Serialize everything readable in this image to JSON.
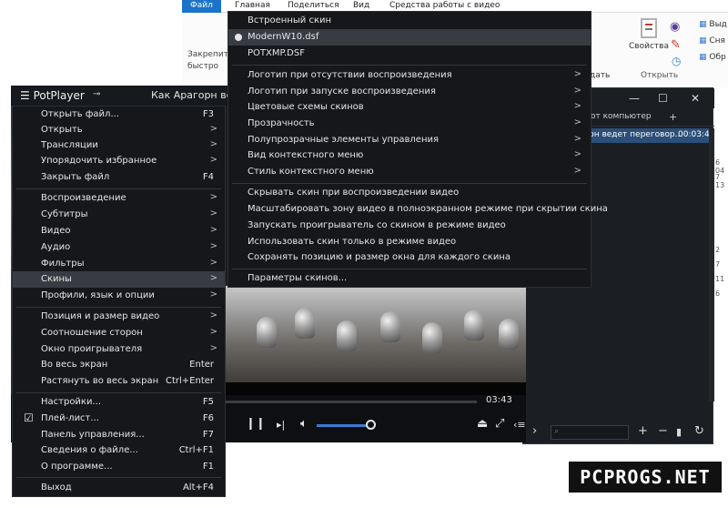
{
  "ribbon": {
    "tabs": [
      "Файл",
      "Главная",
      "Поделиться",
      "Вид",
      "Средства работы с видео"
    ],
    "pin_line1": "Закрепит",
    "pin_line2": "быстро",
    "properties": "Свойства",
    "open_group": "Открыть",
    "cut_label": "дать",
    "right_items": [
      "Выд",
      "Сня",
      "Обр"
    ]
  },
  "player": {
    "app_name": "PotPlayer",
    "title": "Как Арагорн ведет",
    "time_right": "03:43"
  },
  "playlist": {
    "tab_label": "от компьютер",
    "add_tab": "+",
    "row_title": "рн ведет переговор...",
    "row_duration": "00:03:43",
    "right_numbers": [
      "6 04",
      "7 13",
      "2",
      "7",
      "11",
      "6"
    ]
  },
  "menu": {
    "items": [
      {
        "label": "Открыть файл...",
        "key": "F3"
      },
      {
        "label": "Открыть",
        "arrow": ">"
      },
      {
        "label": "Трансляции",
        "arrow": ">"
      },
      {
        "label": "Упорядочить избранное",
        "arrow": ">"
      },
      {
        "label": "Закрыть файл",
        "key": "F4"
      },
      {
        "label": "Воспроизведение",
        "arrow": ">"
      },
      {
        "label": "Субтитры",
        "arrow": ">"
      },
      {
        "label": "Видео",
        "arrow": ">"
      },
      {
        "label": "Аудио",
        "arrow": ">"
      },
      {
        "label": "Фильтры",
        "arrow": ">"
      },
      {
        "label": "Скины",
        "arrow": ">"
      },
      {
        "label": "Профили, язык и опции",
        "arrow": ">"
      },
      {
        "label": "Позиция и размер видео",
        "arrow": ">"
      },
      {
        "label": "Соотношение сторон",
        "arrow": ">"
      },
      {
        "label": "Окно проигрывателя",
        "arrow": ">"
      },
      {
        "label": "Во весь экран",
        "key": "Enter"
      },
      {
        "label": "Растянуть во весь экран",
        "key": "Ctrl+Enter"
      },
      {
        "label": "Настройки...",
        "key": "F5"
      },
      {
        "label": "Плей-лист...",
        "key": "F6"
      },
      {
        "label": "Панель управления...",
        "key": "F7"
      },
      {
        "label": "Сведения о файле...",
        "key": "Ctrl+F1"
      },
      {
        "label": "О программе...",
        "key": "F1"
      },
      {
        "label": "Выход",
        "key": "Alt+F4"
      }
    ]
  },
  "submenu": {
    "items": [
      {
        "label": "Встроенный скин"
      },
      {
        "label": "ModernW10.dsf"
      },
      {
        "label": "POTXMP.DSF"
      },
      {
        "label": "Логотип при отсутствии воспроизведения",
        "arrow": ">"
      },
      {
        "label": "Логотип при запуске воспроизведения",
        "arrow": ">"
      },
      {
        "label": "Цветовые схемы скинов",
        "arrow": ">"
      },
      {
        "label": "Прозрачность",
        "arrow": ">"
      },
      {
        "label": "Полупрозрачные элементы управления",
        "arrow": ">"
      },
      {
        "label": "Вид контекстного меню",
        "arrow": ">"
      },
      {
        "label": "Стиль контекстного меню",
        "arrow": ">"
      },
      {
        "label": "Скрывать скин при воспроизведении видео"
      },
      {
        "label": "Масштабировать зону видео в полноэкранном режиме при скрытии скина"
      },
      {
        "label": "Запускать проигрыватель со скином в режиме видео"
      },
      {
        "label": "Использовать скин только в режиме видео"
      },
      {
        "label": "Сохранять позицию и размер окна для каждого скина"
      },
      {
        "label": "Параметры скинов..."
      }
    ]
  },
  "watermark": "PCPROGS.NET"
}
